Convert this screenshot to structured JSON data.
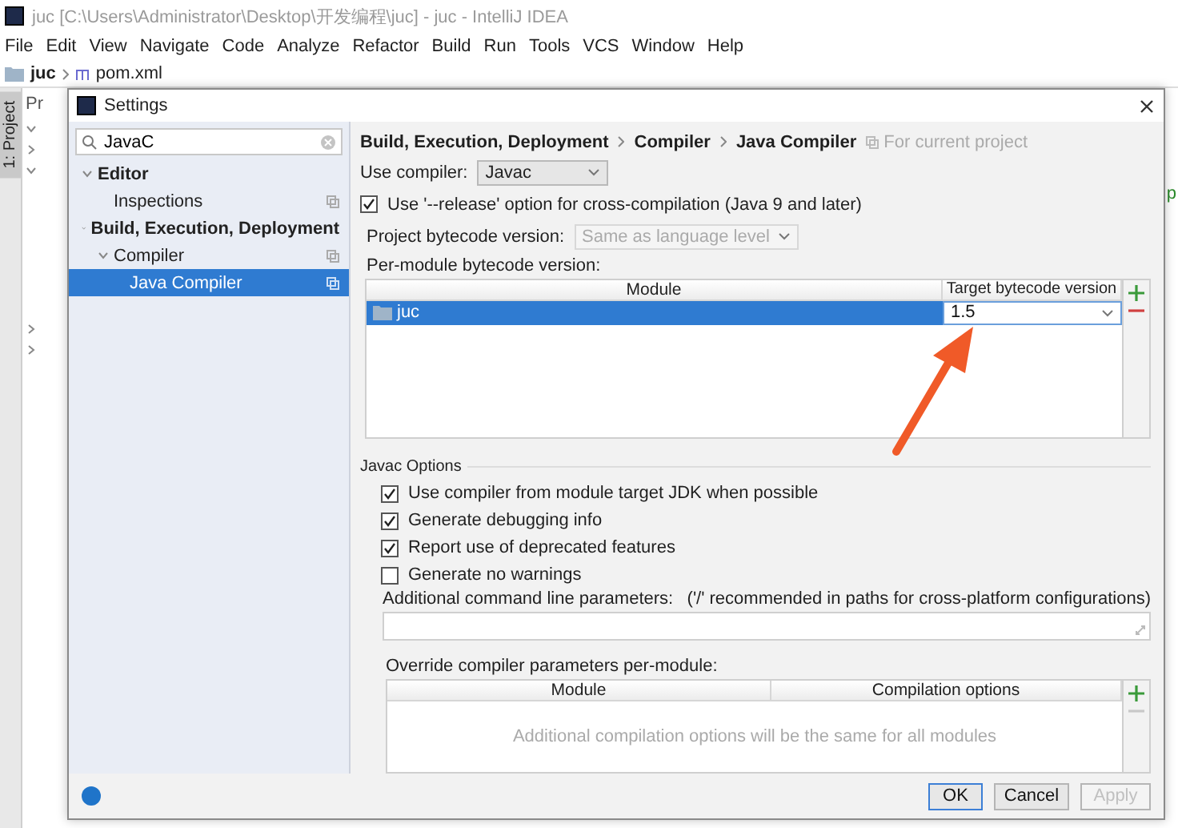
{
  "ide": {
    "title": "juc [C:\\Users\\Administrator\\Desktop\\开发编程\\juc] - juc - IntelliJ IDEA",
    "menu": [
      "File",
      "Edit",
      "View",
      "Navigate",
      "Code",
      "Analyze",
      "Refactor",
      "Build",
      "Run",
      "Tools",
      "VCS",
      "Window",
      "Help"
    ],
    "breadcrumb": [
      "juc",
      "pom.xml"
    ],
    "tool_window_tab": "1: Project",
    "project_panel_label": "Pr",
    "editor_edge_text": "p"
  },
  "dialog": {
    "title": "Settings",
    "search": {
      "value": "JavaC"
    },
    "tree": [
      {
        "label": "Editor",
        "expanded": true,
        "selected": false,
        "children": [
          {
            "label": "Inspections",
            "selected": false
          }
        ]
      },
      {
        "label": "Build, Execution, Deployment",
        "expanded": true,
        "selected": false,
        "children": [
          {
            "label": "Compiler",
            "expanded": true,
            "selected": false,
            "children": [
              {
                "label": "Java Compiler",
                "selected": true
              }
            ]
          }
        ]
      }
    ],
    "breadcrumb": [
      "Build, Execution, Deployment",
      "Compiler",
      "Java Compiler"
    ],
    "scope_note": "For current project",
    "use_compiler": {
      "label": "Use compiler:",
      "value": "Javac"
    },
    "release_option": {
      "label": "Use '--release' option for cross-compilation (Java 9 and later)",
      "checked": true
    },
    "project_bytecode": {
      "label": "Project bytecode version:",
      "value": "Same as language level",
      "disabled": true
    },
    "per_module_label": "Per-module bytecode version:",
    "module_table": {
      "columns": [
        "Module",
        "Target bytecode version"
      ],
      "rows": [
        {
          "module": "juc",
          "target": "1.5",
          "selected": true
        }
      ]
    },
    "javac_options": {
      "title": "Javac Options",
      "options": [
        {
          "label": "Use compiler from module target JDK when possible",
          "checked": true
        },
        {
          "label": "Generate debugging info",
          "checked": true
        },
        {
          "label": "Report use of deprecated features",
          "checked": true
        },
        {
          "label": "Generate no warnings",
          "checked": false
        }
      ],
      "params_label": "Additional command line parameters:",
      "params_hint": "('/' recommended in paths for cross-platform configurations)",
      "override_label": "Override compiler parameters per-module:",
      "override_table": {
        "columns": [
          "Module",
          "Compilation options"
        ],
        "empty_text": "Additional compilation options will be the same for all modules"
      }
    },
    "buttons": [
      {
        "label": "OK",
        "kind": "default"
      },
      {
        "label": "Cancel",
        "kind": "normal"
      },
      {
        "label": "Apply",
        "kind": "disabled"
      }
    ]
  }
}
